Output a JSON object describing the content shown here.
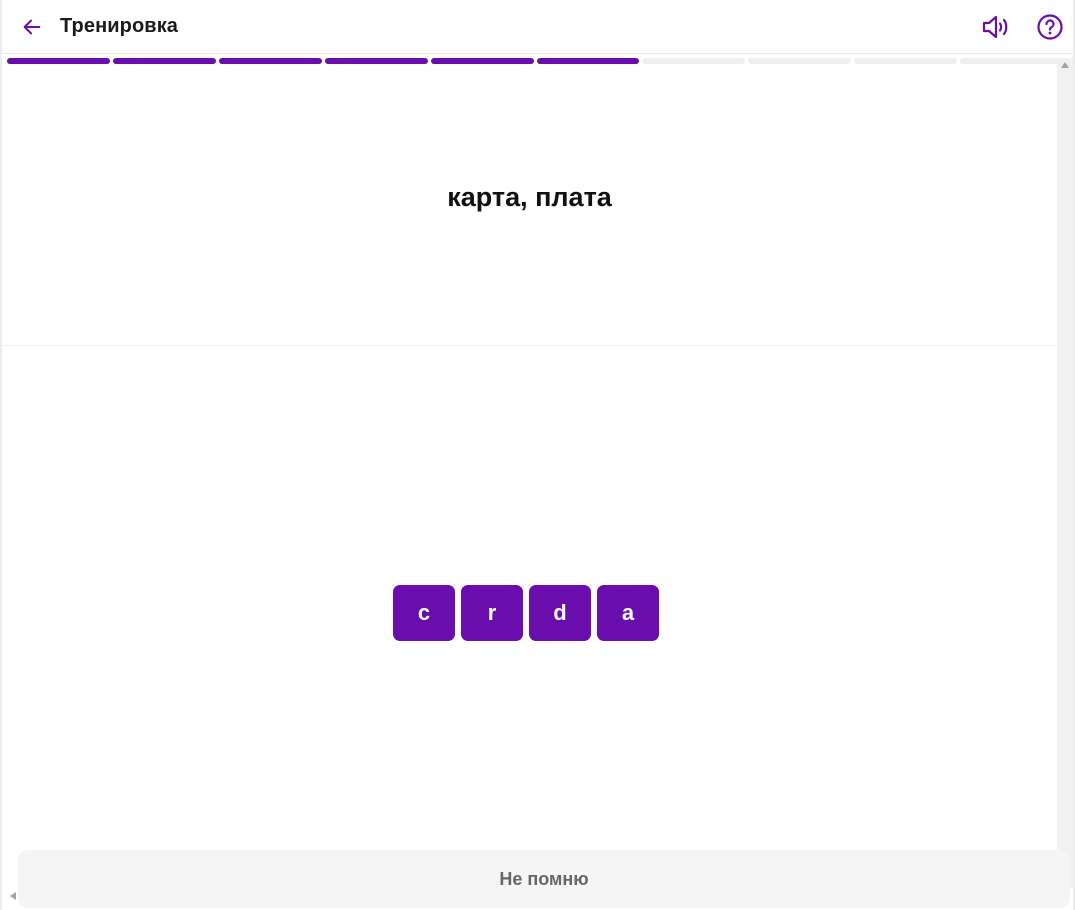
{
  "header": {
    "title": "Тренировка",
    "back_icon": "arrow-left-icon",
    "sound_icon": "speaker-icon",
    "help_icon": "question-circle-icon"
  },
  "progress": {
    "completed": 6,
    "total": 10
  },
  "question": {
    "text": "карта, плата"
  },
  "letters": [
    "c",
    "r",
    "d",
    "a"
  ],
  "actions": {
    "dont_remember_label": "Не помню"
  },
  "colors": {
    "accent": "#6a0dad",
    "progress_empty": "#efefef",
    "button_bg": "#f5f5f5"
  }
}
